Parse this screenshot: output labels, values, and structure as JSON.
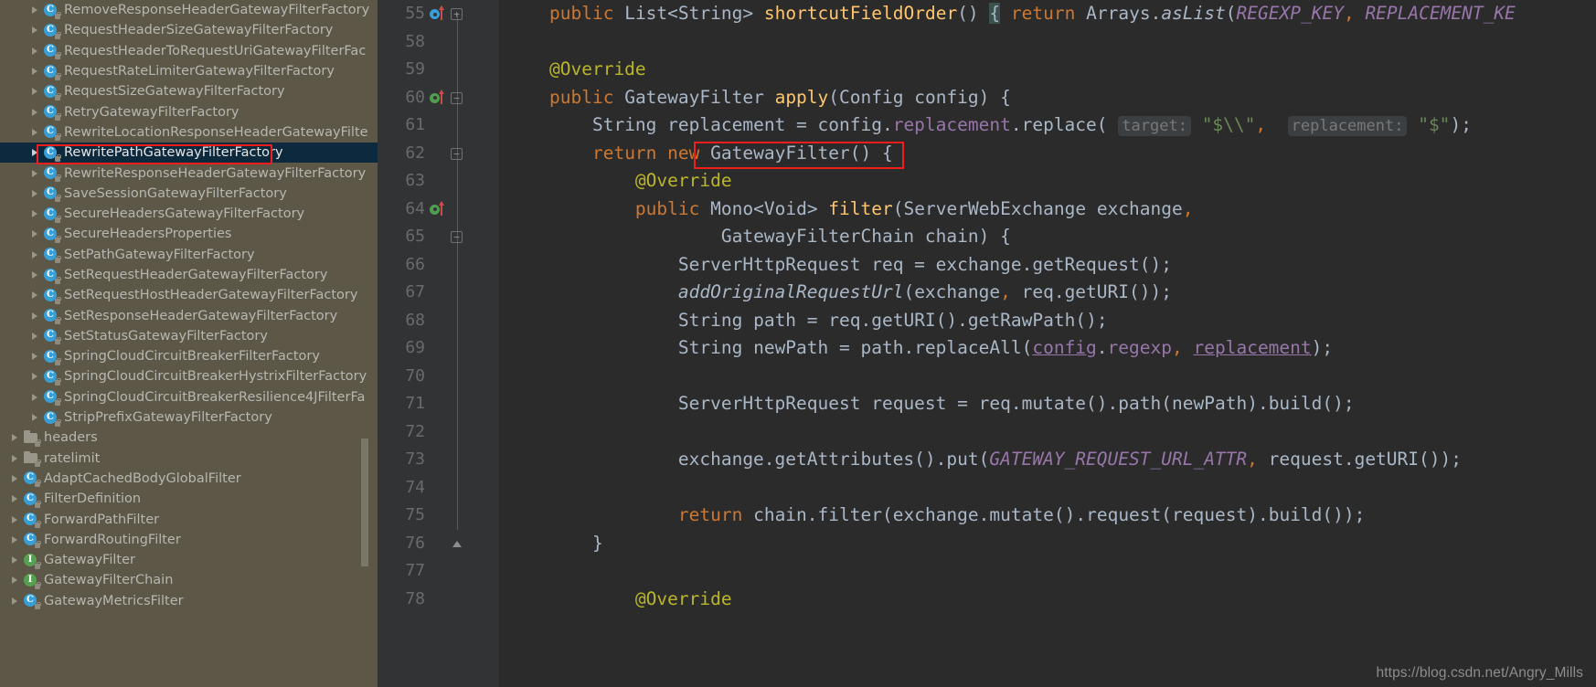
{
  "project_tree": {
    "name": "project-file-tree",
    "items": [
      {
        "label": "RemoveResponseHeaderGatewayFilterFactory",
        "icon": "java-class-icon",
        "indent": 1,
        "selected": false
      },
      {
        "label": "RequestHeaderSizeGatewayFilterFactory",
        "icon": "java-class-icon",
        "indent": 1,
        "selected": false
      },
      {
        "label": "RequestHeaderToRequestUriGatewayFilterFac",
        "icon": "java-class-icon",
        "indent": 1,
        "selected": false
      },
      {
        "label": "RequestRateLimiterGatewayFilterFactory",
        "icon": "java-class-icon",
        "indent": 1,
        "selected": false
      },
      {
        "label": "RequestSizeGatewayFilterFactory",
        "icon": "java-class-icon",
        "indent": 1,
        "selected": false
      },
      {
        "label": "RetryGatewayFilterFactory",
        "icon": "java-class-icon",
        "indent": 1,
        "selected": false
      },
      {
        "label": "RewriteLocationResponseHeaderGatewayFilte",
        "icon": "java-class-icon",
        "indent": 1,
        "selected": false
      },
      {
        "label": "RewritePathGatewayFilterFactory",
        "icon": "java-class-icon",
        "indent": 1,
        "selected": true
      },
      {
        "label": "RewriteResponseHeaderGatewayFilterFactory",
        "icon": "java-class-icon",
        "indent": 1,
        "selected": false
      },
      {
        "label": "SaveSessionGatewayFilterFactory",
        "icon": "java-class-icon",
        "indent": 1,
        "selected": false
      },
      {
        "label": "SecureHeadersGatewayFilterFactory",
        "icon": "java-class-icon",
        "indent": 1,
        "selected": false
      },
      {
        "label": "SecureHeadersProperties",
        "icon": "java-class-icon",
        "indent": 1,
        "selected": false
      },
      {
        "label": "SetPathGatewayFilterFactory",
        "icon": "java-class-icon",
        "indent": 1,
        "selected": false
      },
      {
        "label": "SetRequestHeaderGatewayFilterFactory",
        "icon": "java-class-icon",
        "indent": 1,
        "selected": false
      },
      {
        "label": "SetRequestHostHeaderGatewayFilterFactory",
        "icon": "java-class-icon",
        "indent": 1,
        "selected": false
      },
      {
        "label": "SetResponseHeaderGatewayFilterFactory",
        "icon": "java-class-icon",
        "indent": 1,
        "selected": false
      },
      {
        "label": "SetStatusGatewayFilterFactory",
        "icon": "java-class-icon",
        "indent": 1,
        "selected": false
      },
      {
        "label": "SpringCloudCircuitBreakerFilterFactory",
        "icon": "java-class-icon",
        "indent": 1,
        "selected": false
      },
      {
        "label": "SpringCloudCircuitBreakerHystrixFilterFactory",
        "icon": "java-class-icon",
        "indent": 1,
        "selected": false
      },
      {
        "label": "SpringCloudCircuitBreakerResilience4JFilterFa",
        "icon": "java-class-icon",
        "indent": 1,
        "selected": false
      },
      {
        "label": "StripPrefixGatewayFilterFactory",
        "icon": "java-class-icon",
        "indent": 1,
        "selected": false
      },
      {
        "label": "headers",
        "icon": "folder-icon",
        "indent": 0,
        "selected": false
      },
      {
        "label": "ratelimit",
        "icon": "folder-icon",
        "indent": 0,
        "selected": false
      },
      {
        "label": "AdaptCachedBodyGlobalFilter",
        "icon": "java-class-icon",
        "indent": 0,
        "selected": false
      },
      {
        "label": "FilterDefinition",
        "icon": "java-class-icon",
        "indent": 0,
        "selected": false
      },
      {
        "label": "ForwardPathFilter",
        "icon": "java-class-icon",
        "indent": 0,
        "selected": false
      },
      {
        "label": "ForwardRoutingFilter",
        "icon": "java-class-icon",
        "indent": 0,
        "selected": false
      },
      {
        "label": "GatewayFilter",
        "icon": "java-interface-icon",
        "indent": 0,
        "selected": false
      },
      {
        "label": "GatewayFilterChain",
        "icon": "java-interface-icon",
        "indent": 0,
        "selected": false
      },
      {
        "label": "GatewayMetricsFilter",
        "icon": "java-class-icon",
        "indent": 0,
        "selected": false
      }
    ]
  },
  "editor": {
    "name": "java-code-editor",
    "line_numbers": [
      "55",
      "58",
      "59",
      "60",
      "61",
      "62",
      "63",
      "64",
      "65",
      "66",
      "67",
      "68",
      "69",
      "70",
      "71",
      "72",
      "73",
      "74",
      "75",
      "76",
      "77",
      "78"
    ],
    "gutter_markers": [
      {
        "line": "55",
        "type": "overriding-method-marker",
        "color": "#389fd6"
      },
      {
        "line": "60",
        "type": "implementing-method-marker",
        "color": "#4f9e4f"
      },
      {
        "line": "64",
        "type": "implementing-method-marker",
        "color": "#4f9e4f"
      }
    ],
    "code_lines": [
      "public List<String> shortcutFieldOrder() { return Arrays.asList(REGEXP_KEY, REPLACEMENT_KE",
      "",
      "    @Override",
      "    public GatewayFilter apply(Config config) {",
      "        String replacement = config.replacement.replace( target: \"$\\\\\", replacement: \"$\");",
      "        return new GatewayFilter() {",
      "            @Override",
      "            public Mono<Void> filter(ServerWebExchange exchange,",
      "                    GatewayFilterChain chain) {",
      "                ServerHttpRequest req = exchange.getRequest();",
      "                addOriginalRequestUrl(exchange, req.getURI());",
      "                String path = req.getURI().getRawPath();",
      "                String newPath = path.replaceAll(config.regexp, replacement);",
      "",
      "                ServerHttpRequest request = req.mutate().path(newPath).build();",
      "",
      "                exchange.getAttributes().put(GATEWAY_REQUEST_URL_ATTR, request.getURI());",
      "",
      "                return chain.filter(exchange.mutate().request(request).build());",
      "            }",
      "",
      "            @Override"
    ],
    "inlay_hints": [
      "target:",
      "replacement:"
    ],
    "highlighted_code_snippet": "new GatewayFilter()",
    "highlighted_tree_item": "RewritePathGatewayFilterFactory"
  },
  "watermark": {
    "text": "https://blog.csdn.net/Angry_Mills"
  },
  "colors": {
    "sidebar_bg": "#5c5747",
    "selection_bg": "#0d293e",
    "editor_bg": "#2b2b2b",
    "gutter_bg": "#313335",
    "annotation_highlight": "#f21e1e",
    "keyword": "#cc7832",
    "string": "#6a8759",
    "annotation": "#bbb529",
    "method": "#ffc66d",
    "field": "#9876aa",
    "default_text": "#a9b7c6"
  }
}
